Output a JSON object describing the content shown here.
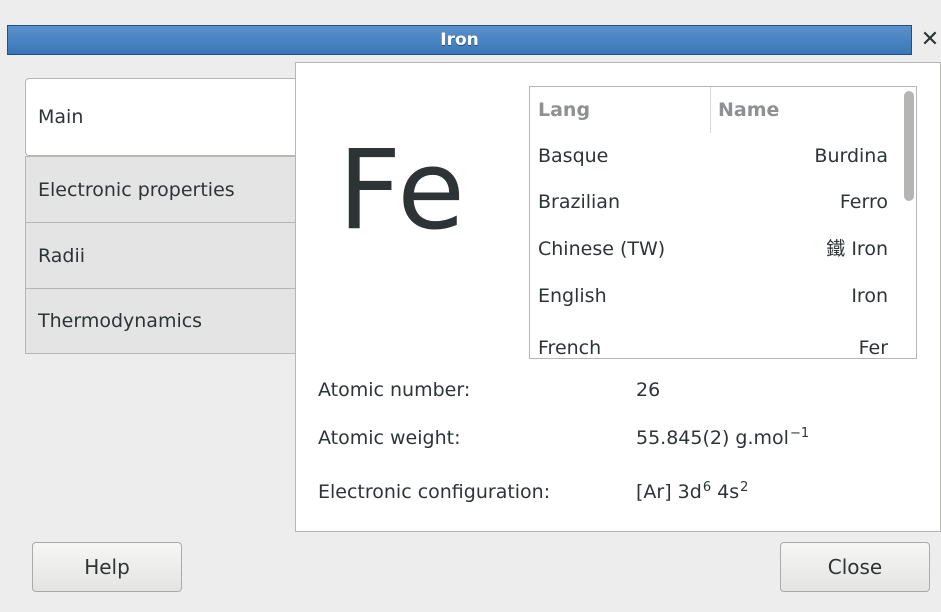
{
  "window": {
    "title": "Iron",
    "close_glyph": "✕"
  },
  "tabs": [
    {
      "label": "Main",
      "active": true
    },
    {
      "label": "Electronic properties",
      "active": false
    },
    {
      "label": "Radii",
      "active": false
    },
    {
      "label": "Thermodynamics",
      "active": false
    }
  ],
  "element": {
    "symbol": "Fe",
    "names_table": {
      "headers": {
        "lang": "Lang",
        "name": "Name"
      },
      "rows": [
        {
          "lang": "Basque",
          "name": "Burdina"
        },
        {
          "lang": "Brazilian",
          "name": "Ferro"
        },
        {
          "lang": "Chinese (TW)",
          "name": "鐵 Iron"
        },
        {
          "lang": "English",
          "name": "Iron"
        },
        {
          "lang": "French",
          "name": "Fer"
        }
      ]
    },
    "properties": {
      "atomic_number": {
        "label": "Atomic number:",
        "value": "26"
      },
      "atomic_weight": {
        "label": "Atomic weight:",
        "value": "55.845(2) g.mol",
        "unit_exp": "−1"
      },
      "electronic_configuration": {
        "label": "Electronic configuration:",
        "prefix": "[Ar] 3d",
        "exp1": "6",
        "mid": " 4s",
        "exp2": "2"
      }
    }
  },
  "buttons": {
    "help": "Help",
    "close": "Close"
  },
  "colors": {
    "titlebar": "#3a77b8",
    "background": "#ededed"
  }
}
